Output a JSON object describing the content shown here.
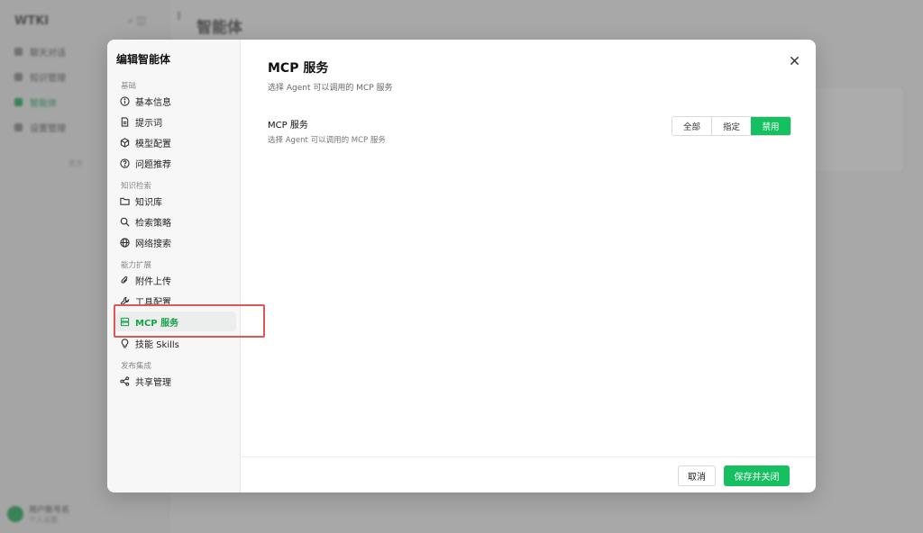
{
  "background": {
    "app_logo": "WTKI",
    "sidebar_items": [
      "聊天对话",
      "知识管理",
      "智能体",
      "设置管理"
    ],
    "more_text": "更多",
    "user_name": "用户账号名",
    "user_sub": "个人设置",
    "page_title": "智能体"
  },
  "modal": {
    "title": "编辑智能体",
    "groups": {
      "basic": "基础",
      "knowledge": "知识检索",
      "capability": "能力扩展",
      "publish": "发布集成"
    },
    "nav": {
      "basic_info": {
        "label": "基本信息",
        "icon": "info-icon"
      },
      "prompt": {
        "label": "提示词",
        "icon": "document-icon"
      },
      "model": {
        "label": "模型配置",
        "icon": "cube-icon"
      },
      "question": {
        "label": "问题推荐",
        "icon": "question-icon"
      },
      "kb": {
        "label": "知识库",
        "icon": "folder-icon"
      },
      "strategy": {
        "label": "检索策略",
        "icon": "search-icon"
      },
      "web": {
        "label": "网络搜索",
        "icon": "globe-icon"
      },
      "attach": {
        "label": "附件上传",
        "icon": "paperclip-icon"
      },
      "tools": {
        "label": "工具配置",
        "icon": "wrench-icon"
      },
      "mcp": {
        "label": "MCP 服务",
        "icon": "server-icon"
      },
      "skills": {
        "label": "技能 Skills",
        "icon": "bulb-icon"
      },
      "share": {
        "label": "共享管理",
        "icon": "share-icon"
      }
    },
    "main": {
      "title": "MCP 服务",
      "subtitle": "选择 Agent 可以调用的 MCP 服务",
      "setting_label": "MCP 服务",
      "setting_desc": "选择 Agent 可以调用的 MCP 服务",
      "options": [
        "全部",
        "指定",
        "禁用"
      ],
      "selected": "禁用"
    },
    "footer": {
      "cancel": "取消",
      "save": "保存并关闭"
    }
  },
  "colors": {
    "accent": "#16c060",
    "active_text": "#16a34a",
    "highlight": "#e05656"
  }
}
